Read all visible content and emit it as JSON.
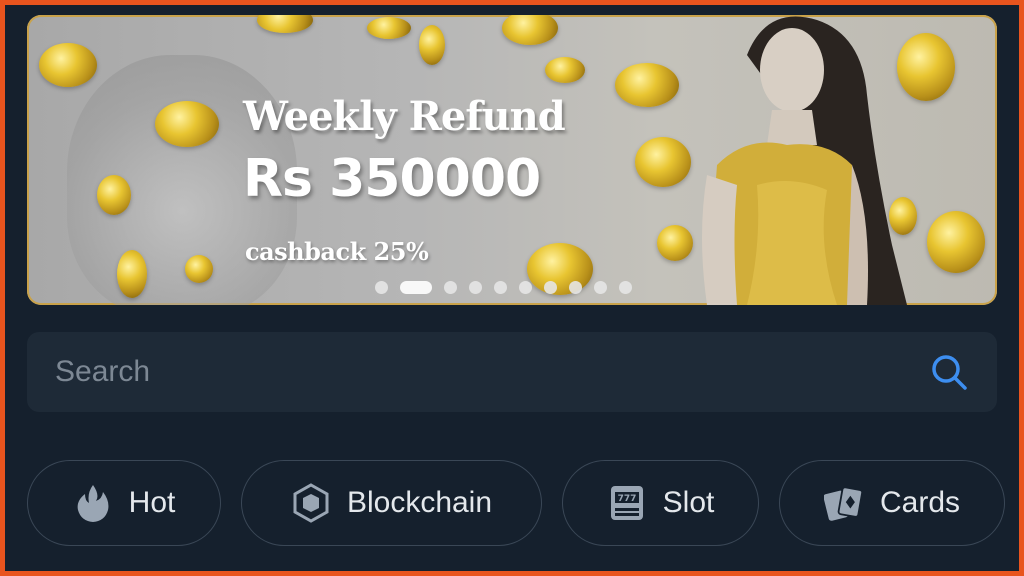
{
  "banner": {
    "title": "Weekly Refund",
    "amount": "Rs 350000",
    "subtitle": "cashback 25%",
    "slides_total": 10,
    "active_slide": 2
  },
  "search": {
    "placeholder": "Search",
    "value": ""
  },
  "categories": [
    {
      "label": "Hot",
      "icon": "flame-icon"
    },
    {
      "label": "Blockchain",
      "icon": "cube-icon"
    },
    {
      "label": "Slot",
      "icon": "slot-machine-icon"
    },
    {
      "label": "Cards",
      "icon": "playing-cards-icon"
    }
  ],
  "colors": {
    "background": "#15202d",
    "surface": "#1e2a37",
    "accent": "#3d8ef0",
    "frame": "#e8541e"
  }
}
